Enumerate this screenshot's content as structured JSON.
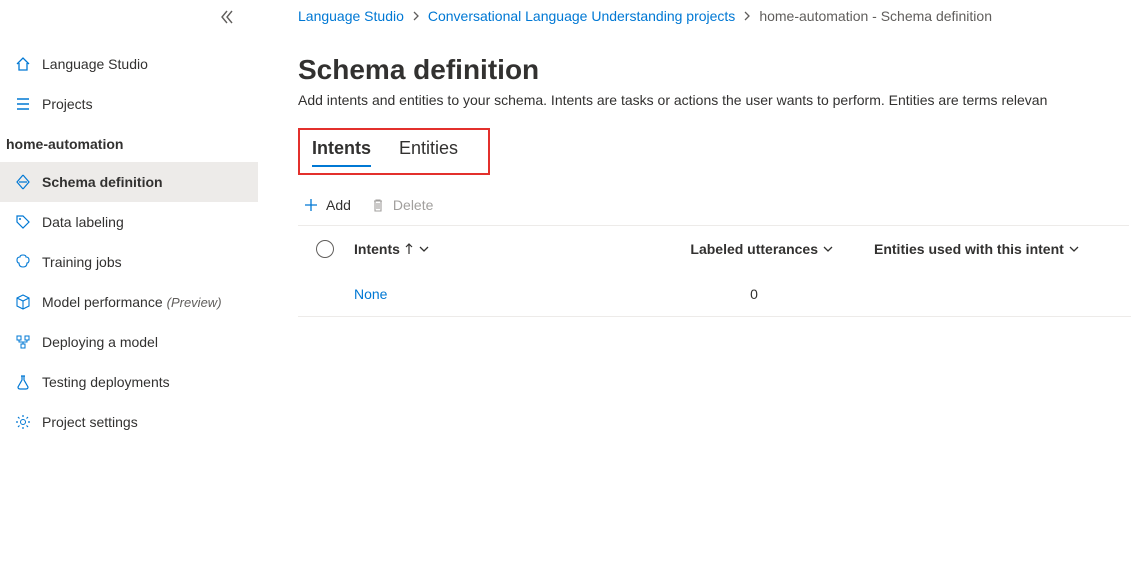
{
  "sidebar": {
    "top_items": [
      {
        "label": "Language Studio",
        "icon": "home"
      },
      {
        "label": "Projects",
        "icon": "list"
      }
    ],
    "project_name": "home-automation",
    "items": [
      {
        "label": "Schema definition",
        "icon": "schema",
        "active": true
      },
      {
        "label": "Data labeling",
        "icon": "tag"
      },
      {
        "label": "Training jobs",
        "icon": "brain"
      },
      {
        "label": "Model performance",
        "icon": "cube",
        "preview": "(Preview)"
      },
      {
        "label": "Deploying a model",
        "icon": "deploy"
      },
      {
        "label": "Testing deployments",
        "icon": "flask"
      },
      {
        "label": "Project settings",
        "icon": "gear"
      }
    ]
  },
  "breadcrumb": {
    "items": [
      {
        "label": "Language Studio",
        "link": true
      },
      {
        "label": "Conversational Language Understanding projects",
        "link": true
      },
      {
        "label": "home-automation - Schema definition",
        "link": false
      }
    ]
  },
  "page": {
    "title": "Schema definition",
    "description": "Add intents and entities to your schema. Intents are tasks or actions the user wants to perform. Entities are terms relevan"
  },
  "tabs": {
    "items": [
      {
        "label": "Intents",
        "active": true
      },
      {
        "label": "Entities",
        "active": false
      }
    ]
  },
  "toolbar": {
    "add_label": "Add",
    "delete_label": "Delete"
  },
  "table": {
    "columns": {
      "intents": "Intents",
      "utterances": "Labeled utterances",
      "entities": "Entities used with this intent"
    },
    "rows": [
      {
        "intent": "None",
        "utterances": "0",
        "entities": ""
      }
    ]
  }
}
